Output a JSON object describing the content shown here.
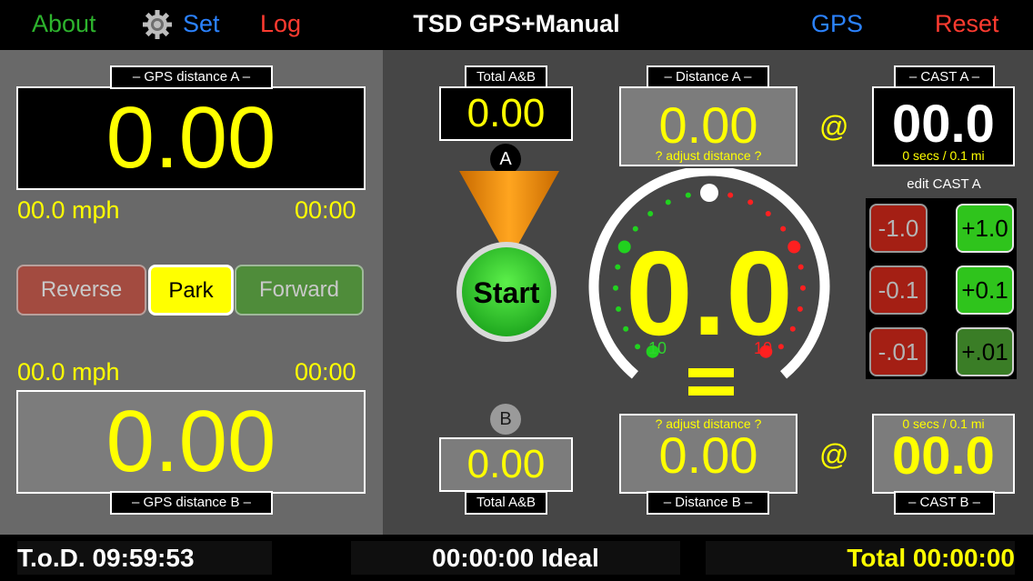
{
  "app": {
    "title": "TSD GPS+Manual",
    "about": "About",
    "set": "Set",
    "log": "Log",
    "gps": "GPS",
    "reset": "Reset"
  },
  "left": {
    "gps_a_label": "– GPS distance A –",
    "gps_a_value": "0.00",
    "speed_a": "00.0 mph",
    "time_a": "00:00",
    "reverse": "Reverse",
    "park": "Park",
    "forward": "Forward",
    "speed_b": "00.0 mph",
    "time_b": "00:00",
    "gps_b_value": "0.00",
    "gps_b_label": "– GPS distance B –"
  },
  "right": {
    "total_ab_top_label": "Total A&B",
    "total_ab_top_value": "0.00",
    "badge_a": "A",
    "start": "Start",
    "badge_b": "B",
    "total_ab_bottom_value": "0.00",
    "total_ab_bottom_label": "Total A&B",
    "distance_a_label": "– Distance A –",
    "distance_a_value": "0.00",
    "distance_a_hint": "? adjust distance ?",
    "at_top": "@",
    "cast_a_label": "– CAST A –",
    "cast_a_value": "00.0",
    "cast_a_unit": "0 secs / 0.1 mi",
    "edit_cast_a": "edit CAST A",
    "gauge_value": "0.0",
    "gauge_left_label": "10",
    "gauge_right_label": "10",
    "gauge_equal": "=",
    "adjust": {
      "minus_1": "-1.0",
      "plus_1": "+1.0",
      "minus_01": "-0.1",
      "plus_01": "+0.1",
      "minus_001": "-.01",
      "plus_001": "+.01"
    },
    "distance_b_hint": "? adjust distance ?",
    "distance_b_value": "0.00",
    "distance_b_label": "– Distance B –",
    "at_bottom": "@",
    "cast_b_unit": "0 secs / 0.1 mi",
    "cast_b_value": "00.0",
    "cast_b_label": "– CAST B –"
  },
  "bottom": {
    "tod": "T.o.D. 09:59:53",
    "ideal": "00:00:00 Ideal",
    "total": "Total 00:00:00"
  },
  "icons": {
    "settings": "gear-icon",
    "start_light": "traffic-light-icon"
  },
  "colors": {
    "about": "#2db32d",
    "set": "#2b82ff",
    "log": "#ff3b30",
    "gps": "#2b82ff",
    "reset": "#ff3b30",
    "value_yellow": "#ffff00",
    "start_green": "#2fd12f",
    "cone_orange": "#f08a00"
  }
}
